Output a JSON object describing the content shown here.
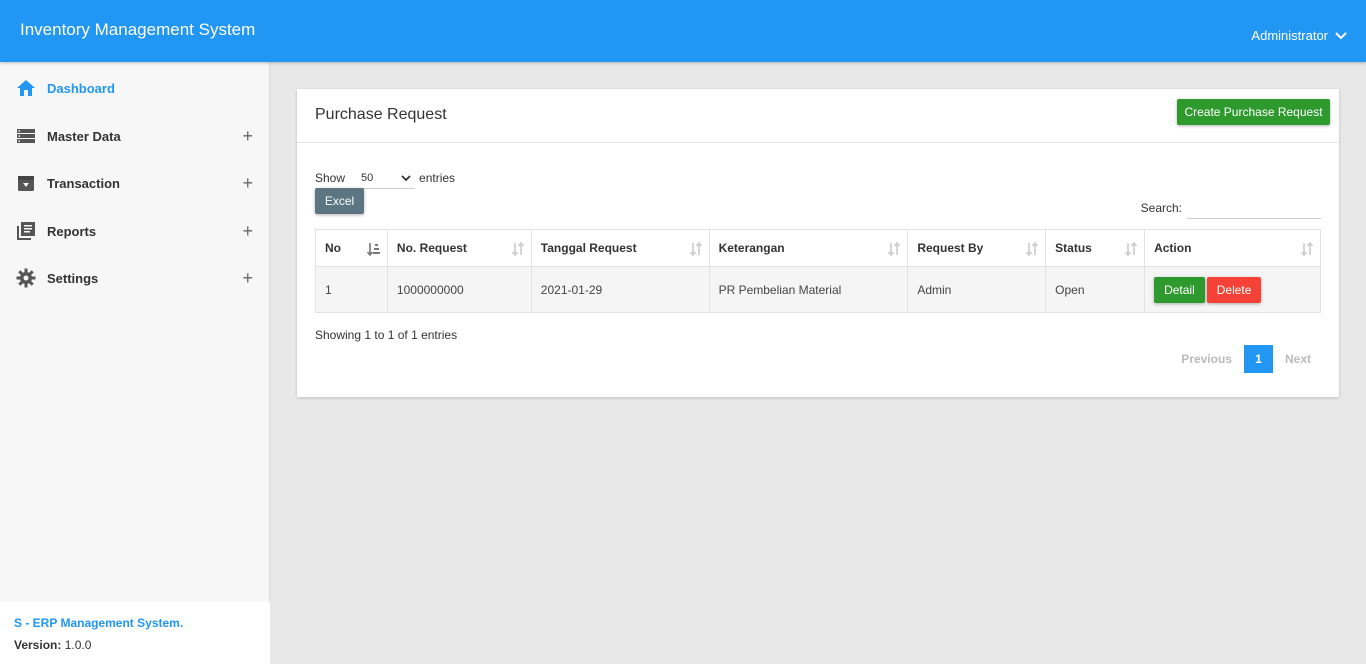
{
  "app": {
    "title": "Inventory Management System",
    "user": "Administrator"
  },
  "sidebar": {
    "items": [
      {
        "label": "Dashboard",
        "icon": "home-icon",
        "active": true,
        "expandable": false
      },
      {
        "label": "Master Data",
        "icon": "list-icon",
        "active": false,
        "expandable": true
      },
      {
        "label": "Transaction",
        "icon": "archive-icon",
        "active": false,
        "expandable": true
      },
      {
        "label": "Reports",
        "icon": "library-books-icon",
        "active": false,
        "expandable": true
      },
      {
        "label": "Settings",
        "icon": "gear-icon",
        "active": false,
        "expandable": true
      }
    ],
    "expand_symbol": "+",
    "footer": {
      "brand": "S - ERP Management System.",
      "version_label": "Version:",
      "version": "1.0.0"
    }
  },
  "page": {
    "title": "Purchase Request",
    "create_button": "Create Purchase Request",
    "show_label": "Show",
    "entries_label": "entries",
    "page_size": "50",
    "excel_button": "Excel",
    "search_label": "Search:",
    "search_value": ""
  },
  "table": {
    "columns": [
      "No",
      "No. Request",
      "Tanggal Request",
      "Keterangan",
      "Request By",
      "Status",
      "Action"
    ],
    "rows": [
      {
        "no": "1",
        "request_no": "1000000000",
        "date": "2021-01-29",
        "description": "PR Pembelian Material",
        "request_by": "Admin",
        "status": "Open",
        "detail_label": "Detail",
        "delete_label": "Delete"
      }
    ]
  },
  "footer_info": {
    "showing": "Showing 1 to 1 of 1 entries",
    "previous": "Previous",
    "current_page": "1",
    "next": "Next"
  },
  "colors": {
    "primary": "#2196f3",
    "success": "#2e9a2e",
    "danger": "#f44336",
    "excel": "#5c7582"
  }
}
